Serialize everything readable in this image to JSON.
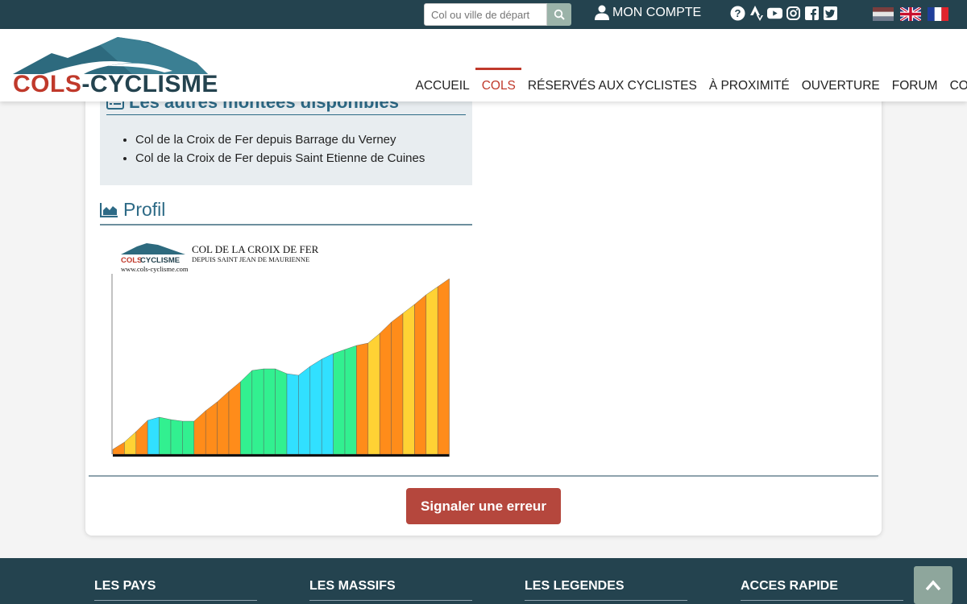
{
  "topbar": {
    "search_placeholder": "Col ou ville de départ",
    "account_label": "MON COMPTE",
    "social_icons": [
      "help-icon",
      "strava-icon",
      "youtube-icon",
      "instagram-icon",
      "facebook-icon",
      "twitter-icon"
    ],
    "flags": [
      "nl-flag",
      "uk-flag",
      "fr-flag"
    ]
  },
  "header": {
    "logo_text_left": "COLS",
    "logo_text_sep": "-",
    "logo_text_right": "CYCLISME",
    "nav": [
      "ACCUEIL",
      "COLS",
      "RÉSERVÉS AUX CYCLISTES",
      "À PROXIMITÉ",
      "OUVERTURE",
      "FORUM",
      "CONTACT"
    ],
    "active_nav": "COLS"
  },
  "others": {
    "title": "Les autres montées disponibles",
    "items": [
      "Col de la Croix de Fer depuis Barrage du Verney",
      "Col de la Croix de Fer depuis Saint Etienne de Cuines"
    ]
  },
  "profil": {
    "title": "Profil",
    "image": {
      "col_name": "COL DE LA CROIX DE FER",
      "subtitle": "DEPUIS SAINT JEAN DE MAURIENNE",
      "site": "www.cols-cyclisme.com",
      "logo_left": "COLS",
      "logo_right": "CYCLISME"
    }
  },
  "report_button": "Signaler une erreur",
  "footer": {
    "columns": [
      "LES PAYS",
      "LES MASSIFS",
      "LES LEGENDES",
      "ACCES RAPIDE"
    ]
  },
  "colors": {
    "topbar": "#24434f",
    "accent_red": "#c0392b",
    "title_blue": "#2d6a86",
    "button_red": "#b5473d",
    "green_btn": "#9bb3a9"
  }
}
